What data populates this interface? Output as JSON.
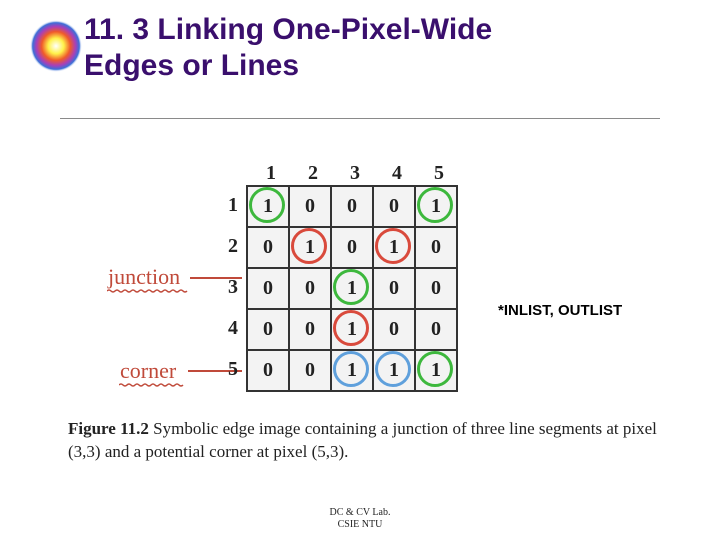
{
  "title": {
    "line1": "11. 3 Linking One-Pixel-Wide",
    "line2": "Edges or Lines"
  },
  "labels": {
    "junction": "junction",
    "corner": "corner",
    "inlist": "*INLIST, OUTLIST"
  },
  "chart_data": {
    "type": "table",
    "col_headers": [
      "1",
      "2",
      "3",
      "4",
      "5"
    ],
    "row_headers": [
      "1",
      "2",
      "3",
      "4",
      "5"
    ],
    "grid": [
      [
        "1",
        "0",
        "0",
        "0",
        "1"
      ],
      [
        "0",
        "1",
        "0",
        "1",
        "0"
      ],
      [
        "0",
        "0",
        "1",
        "0",
        "0"
      ],
      [
        "0",
        "0",
        "1",
        "0",
        "0"
      ],
      [
        "0",
        "0",
        "1",
        "1",
        "1"
      ]
    ],
    "circles": {
      "green": [
        [
          0,
          0
        ],
        [
          0,
          4
        ],
        [
          2,
          2
        ],
        [
          4,
          4
        ]
      ],
      "red": [
        [
          1,
          1
        ],
        [
          1,
          3
        ],
        [
          3,
          2
        ]
      ],
      "blue": [
        [
          4,
          2
        ],
        [
          4,
          3
        ]
      ]
    }
  },
  "caption": {
    "prefix": "Figure 11.2",
    "text": " Symbolic edge image containing a junction of three line segments at pixel (3,3) and a potential corner at pixel (5,3)."
  },
  "footer": {
    "line1": "DC & CV Lab.",
    "line2": "CSIE NTU"
  }
}
